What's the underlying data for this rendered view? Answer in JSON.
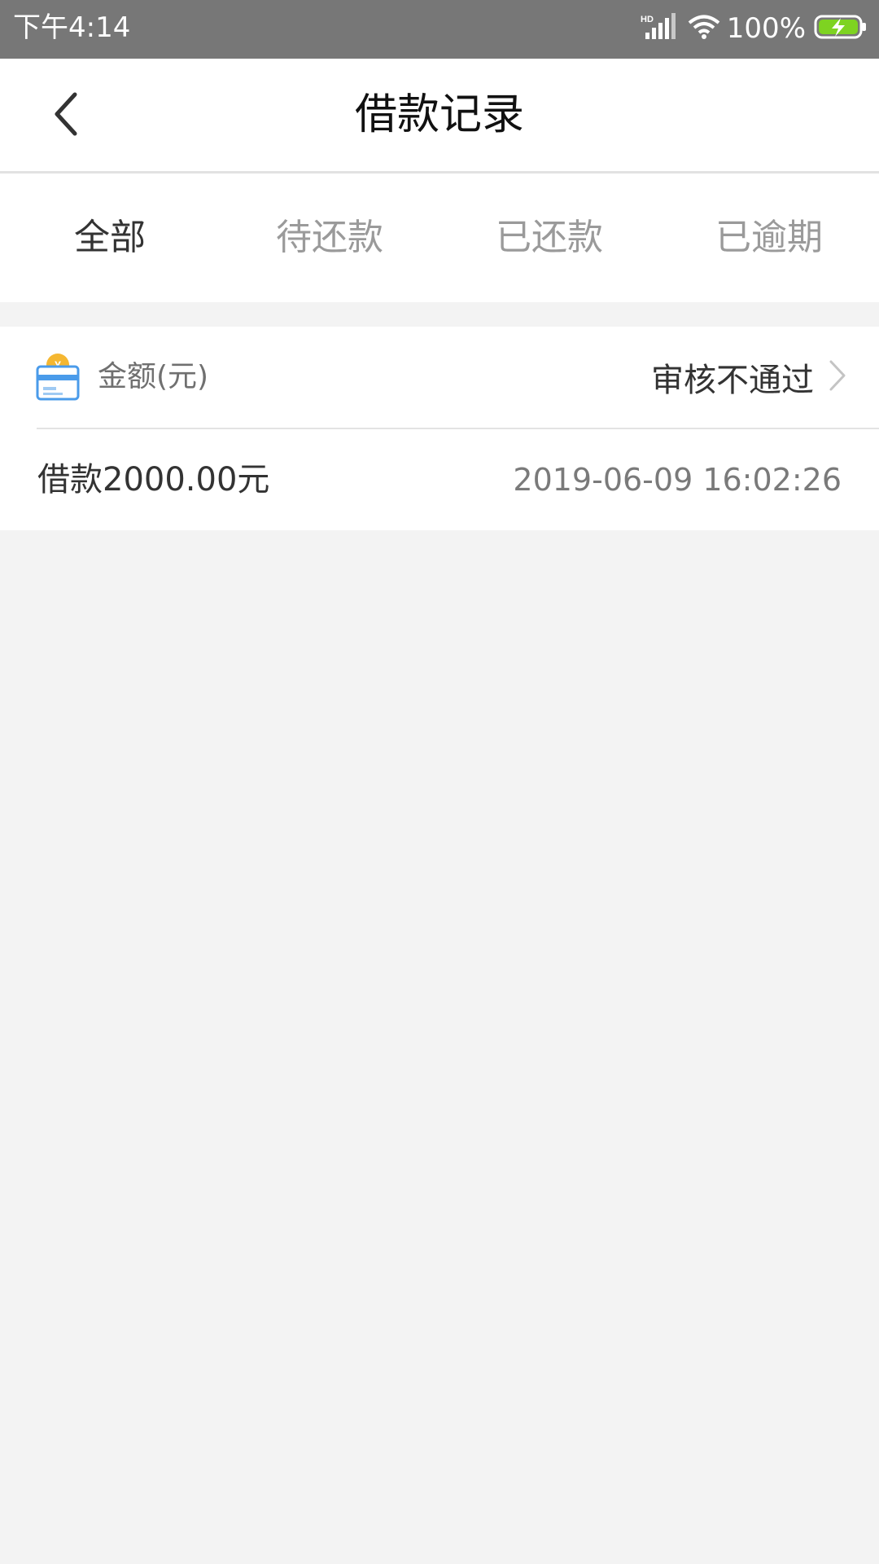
{
  "status_bar": {
    "time": "下午4:14",
    "network": "HD",
    "battery": "100%"
  },
  "nav": {
    "title": "借款记录",
    "back_icon": "chevron-left-icon"
  },
  "tabs": [
    {
      "label": "全部",
      "active": true
    },
    {
      "label": "待还款",
      "active": false
    },
    {
      "label": "已还款",
      "active": false
    },
    {
      "label": "已逾期",
      "active": false
    }
  ],
  "records": [
    {
      "amount_label": "金额(元)",
      "status": "审核不通过",
      "loan": "借款2000.00元",
      "time": "2019-06-09 16:02:26",
      "icon": "card-yuan-icon"
    }
  ],
  "colors": {
    "status_bar": "#777777",
    "background": "#f3f3f3",
    "battery_fill": "#7ed321",
    "icon_blue": "#4a9bea",
    "icon_coin": "#f5b731"
  }
}
